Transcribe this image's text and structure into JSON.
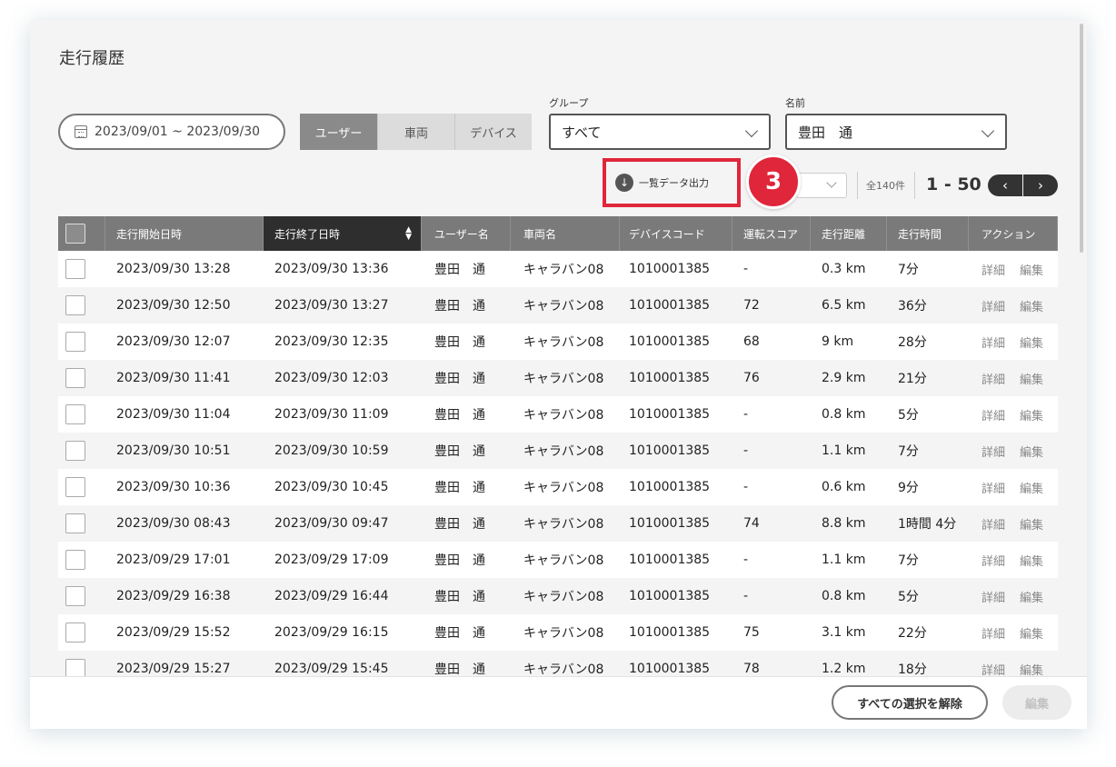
{
  "page": {
    "title": "走行履歴"
  },
  "filters": {
    "date_range": "2023/09/01 ~ 2023/09/30",
    "tabs": [
      {
        "label": "ユーザー",
        "active": true
      },
      {
        "label": "車両",
        "active": false
      },
      {
        "label": "デバイス",
        "active": false
      }
    ],
    "group_label": "グループ",
    "group_value": "すべて",
    "name_label": "名前",
    "name_value": "豊田　通"
  },
  "toolbar": {
    "export_label": "一覧データ出力",
    "step_badge": "3",
    "total": "全140件",
    "range": "1 - 50",
    "prev_glyph": "‹",
    "next_glyph": "›"
  },
  "table": {
    "headers": [
      "走行開始日時",
      "走行終了日時",
      "ユーザー名",
      "車両名",
      "デバイスコード",
      "運転スコア",
      "走行距離",
      "走行時間",
      "アクション"
    ],
    "action_detail": "詳細",
    "action_edit": "編集",
    "rows": [
      [
        "2023/09/30 13:28",
        "2023/09/30 13:36",
        "豊田　通",
        "キャラバン08",
        "1010001385",
        "-",
        "0.3 km",
        "7分"
      ],
      [
        "2023/09/30 12:50",
        "2023/09/30 13:27",
        "豊田　通",
        "キャラバン08",
        "1010001385",
        "72",
        "6.5 km",
        "36分"
      ],
      [
        "2023/09/30 12:07",
        "2023/09/30 12:35",
        "豊田　通",
        "キャラバン08",
        "1010001385",
        "68",
        "9 km",
        "28分"
      ],
      [
        "2023/09/30 11:41",
        "2023/09/30 12:03",
        "豊田　通",
        "キャラバン08",
        "1010001385",
        "76",
        "2.9 km",
        "21分"
      ],
      [
        "2023/09/30 11:04",
        "2023/09/30 11:09",
        "豊田　通",
        "キャラバン08",
        "1010001385",
        "-",
        "0.8 km",
        "5分"
      ],
      [
        "2023/09/30 10:51",
        "2023/09/30 10:59",
        "豊田　通",
        "キャラバン08",
        "1010001385",
        "-",
        "1.1 km",
        "7分"
      ],
      [
        "2023/09/30 10:36",
        "2023/09/30 10:45",
        "豊田　通",
        "キャラバン08",
        "1010001385",
        "-",
        "0.6 km",
        "9分"
      ],
      [
        "2023/09/30 08:43",
        "2023/09/30 09:47",
        "豊田　通",
        "キャラバン08",
        "1010001385",
        "74",
        "8.8 km",
        "1時間 4分"
      ],
      [
        "2023/09/29 17:01",
        "2023/09/29 17:09",
        "豊田　通",
        "キャラバン08",
        "1010001385",
        "-",
        "1.1 km",
        "7分"
      ],
      [
        "2023/09/29 16:38",
        "2023/09/29 16:44",
        "豊田　通",
        "キャラバン08",
        "1010001385",
        "-",
        "0.8 km",
        "5分"
      ],
      [
        "2023/09/29 15:52",
        "2023/09/29 16:15",
        "豊田　通",
        "キャラバン08",
        "1010001385",
        "75",
        "3.1 km",
        "22分"
      ],
      [
        "2023/09/29 15:27",
        "2023/09/29 15:45",
        "豊田　通",
        "キャラバン08",
        "1010001385",
        "78",
        "1.2 km",
        "18分"
      ]
    ]
  },
  "footer": {
    "clear_label": "すべての選択を解除",
    "edit_label": "編集"
  },
  "colors": {
    "highlight": "#e0263a",
    "header_bg": "#7a7a7a",
    "sorted_header_bg": "#2e2e2e"
  },
  "icons": {
    "calendar": "calendar-icon",
    "download": "download-icon",
    "dropdown": "chevron-down-icon"
  }
}
